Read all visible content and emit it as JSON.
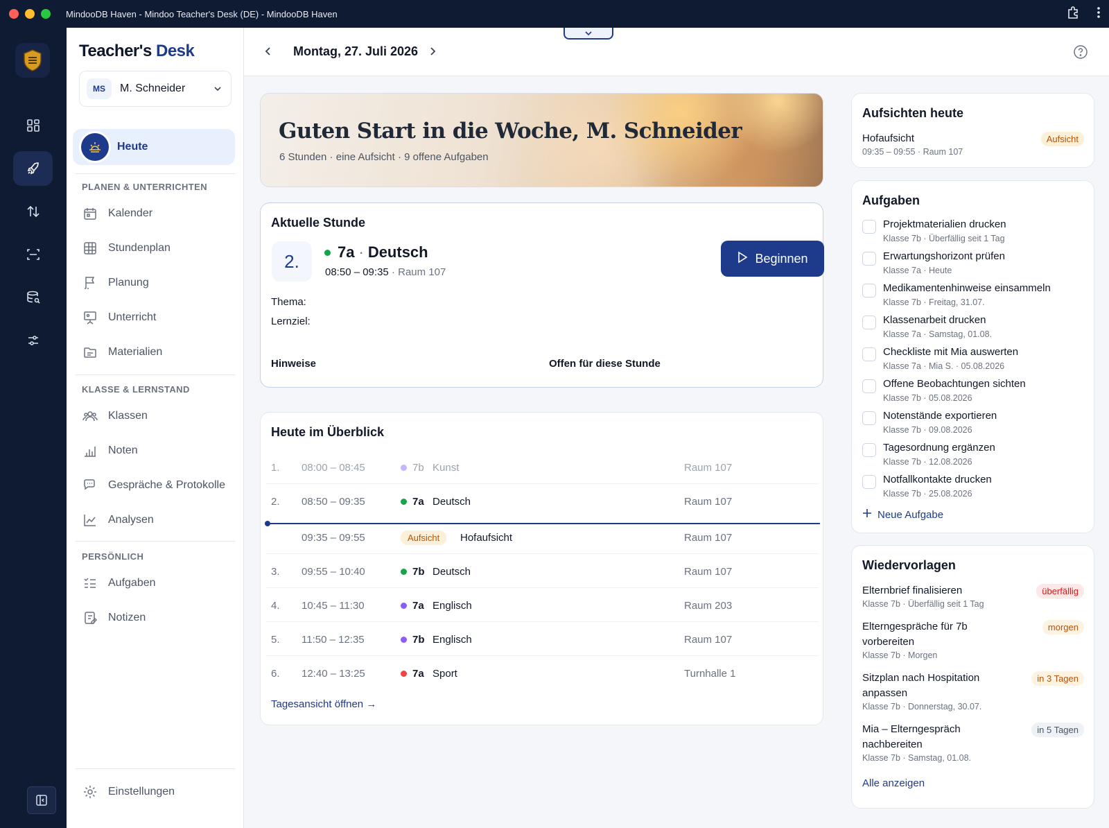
{
  "window": {
    "title": "MindooDB Haven - Mindoo Teacher's Desk (DE) - MindooDB Haven"
  },
  "brand": {
    "part1": "Teacher's",
    "part2": "Desk"
  },
  "user": {
    "initials": "MS",
    "name": "M. Schneider"
  },
  "nav": {
    "today": "Heute",
    "section1": "PLANEN & UNTERRICHTEN",
    "section2": "KLASSE & LERNSTAND",
    "section3": "PERSÖNLICH",
    "items1": [
      "Kalender",
      "Stundenplan",
      "Planung",
      "Unterricht",
      "Materialien"
    ],
    "items2": [
      "Klassen",
      "Noten",
      "Gespräche & Protokolle",
      "Analysen"
    ],
    "items3": [
      "Aufgaben",
      "Notizen"
    ],
    "settings": "Einstellungen"
  },
  "topbar": {
    "date": "Montag, 27. Juli 2026"
  },
  "hero": {
    "title": "Guten Start in die Woche, M. Schneider",
    "subtitle": "6 Stunden · eine Aufsicht · 9 offene Aufgaben"
  },
  "current": {
    "title": "Aktuelle Stunde",
    "number": "2.",
    "class": "7a",
    "subject": "Deutsch",
    "time": "08:50 – 09:35",
    "room": "Raum 107",
    "topic_label": "Thema:",
    "goal_label": "Lernziel:",
    "notes_label": "Hinweise",
    "open_label": "Offen für diese Stunde",
    "begin": "Beginnen",
    "dot_color": "#16a34a"
  },
  "overview": {
    "title": "Heute im Überblick",
    "rows": [
      {
        "n": "1.",
        "time": "08:00 – 08:45",
        "class": "7b",
        "subject": "Kunst",
        "room": "Raum 107",
        "color": "#c4b5fd"
      },
      {
        "n": "2.",
        "time": "08:50 – 09:35",
        "class": "7a",
        "subject": "Deutsch",
        "room": "Raum 107",
        "color": "#16a34a"
      },
      {
        "n": "",
        "time": "09:35 – 09:55",
        "badge": "Aufsicht",
        "subject": "Hofaufsicht",
        "room": "Raum 107"
      },
      {
        "n": "3.",
        "time": "09:55 – 10:40",
        "class": "7b",
        "subject": "Deutsch",
        "room": "Raum 107",
        "color": "#16a34a"
      },
      {
        "n": "4.",
        "time": "10:45 – 11:30",
        "class": "7a",
        "subject": "Englisch",
        "room": "Raum 203",
        "color": "#8b5cf6"
      },
      {
        "n": "5.",
        "time": "11:50 – 12:35",
        "class": "7b",
        "subject": "Englisch",
        "room": "Raum 107",
        "color": "#8b5cf6"
      },
      {
        "n": "6.",
        "time": "12:40 – 13:25",
        "class": "7a",
        "subject": "Sport",
        "room": "Turnhalle 1",
        "color": "#ef4444"
      }
    ],
    "link": "Tagesansicht öffnen →"
  },
  "supervision": {
    "title": "Aufsichten heute",
    "item_title": "Hofaufsicht",
    "item_sub": "09:35 – 09:55 · Raum 107",
    "badge": "Aufsicht"
  },
  "tasks": {
    "title": "Aufgaben",
    "items": [
      {
        "title": "Projektmaterialien drucken",
        "sub": "Klasse 7b · Überfällig seit 1 Tag"
      },
      {
        "title": "Erwartungshorizont prüfen",
        "sub": "Klasse 7a · Heute"
      },
      {
        "title": "Medikamentenhinweise einsammeln",
        "sub": "Klasse 7b · Freitag, 31.07."
      },
      {
        "title": "Klassenarbeit drucken",
        "sub": "Klasse 7a · Samstag, 01.08."
      },
      {
        "title": "Checkliste mit Mia auswerten",
        "sub": "Klasse 7a · Mia S. · 05.08.2026"
      },
      {
        "title": "Offene Beobachtungen sichten",
        "sub": "Klasse 7b · 05.08.2026"
      },
      {
        "title": "Notenstände exportieren",
        "sub": "Klasse 7b · 09.08.2026"
      },
      {
        "title": "Tagesordnung ergänzen",
        "sub": "Klasse 7b · 12.08.2026"
      },
      {
        "title": "Notfallkontakte drucken",
        "sub": "Klasse 7b · 25.08.2026"
      }
    ],
    "new": "Neue Aufgabe"
  },
  "followups": {
    "title": "Wiedervorlagen",
    "items": [
      {
        "line1": "Elternbrief finalisieren",
        "line2": "",
        "sub": "Klasse 7b · Überfällig seit 1 Tag",
        "badge": "überfällig"
      },
      {
        "line1": "Elterngespräche für 7b",
        "line2": "vorbereiten",
        "sub": "Klasse 7b · Morgen",
        "badge": "morgen"
      },
      {
        "line1": "Sitzplan nach Hospitation",
        "line2": "anpassen",
        "sub": "Klasse 7b · Donnerstag, 30.07.",
        "badge": "in 3 Tagen"
      },
      {
        "line1": "Mia – Elterngespräch",
        "line2": "nachbereiten",
        "sub": "Klasse 7b · Samstag, 01.08.",
        "badge": "in 5 Tagen"
      }
    ],
    "link": "Alle anzeigen"
  },
  "colors": {
    "accent": "#1e3a8a",
    "rail": "#0f1a33"
  }
}
